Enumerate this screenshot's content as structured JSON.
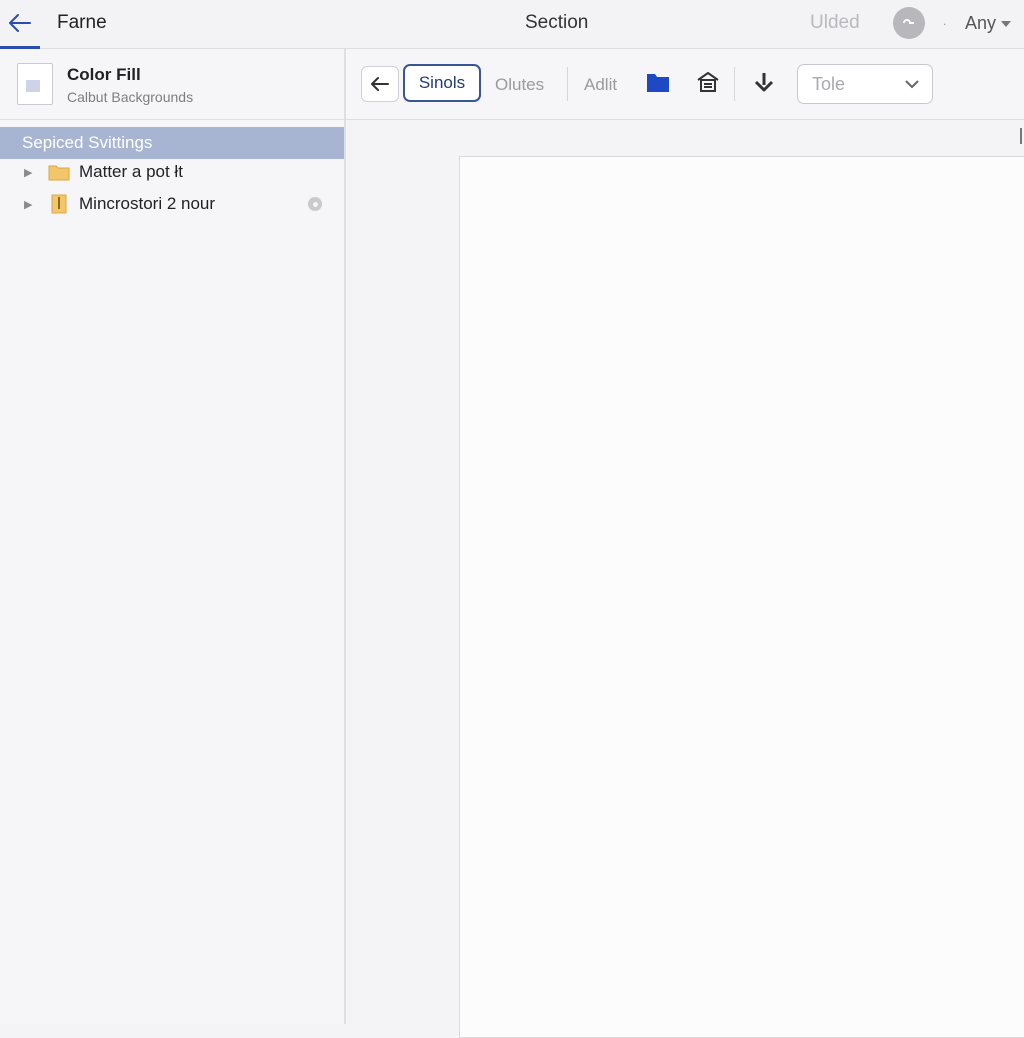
{
  "topbar": {
    "app_title": "Farne",
    "section_title": "Section",
    "status_text": "Ulded",
    "account_label": "Any"
  },
  "sidebar": {
    "file": {
      "name": "Color Fill",
      "subtitle": "Calbut Backgrounds"
    },
    "selected_item": "Sepiced Svittings",
    "items": [
      {
        "label": "Matter a pot łt"
      },
      {
        "label": "Mincrostori 2 nour"
      }
    ]
  },
  "toolbar": {
    "active_tab": "Sinols",
    "tab_2": "Olutes",
    "tab_3": "Adlit",
    "select_value": "Tole"
  },
  "colors": {
    "accent": "#2a4db0",
    "selected_row": "#a7b5d3",
    "folder_blue": "#1f49c4"
  },
  "icons": {
    "back": "arrow-left-icon",
    "folder": "folder-icon",
    "home": "home-icon",
    "download": "download-icon"
  }
}
